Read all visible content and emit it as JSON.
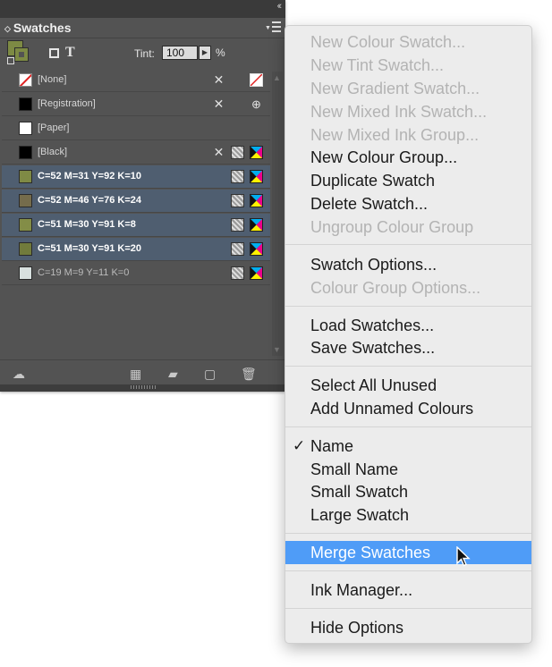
{
  "panel": {
    "tab_title": "Swatches",
    "collapse_glyph": "‹‹",
    "tint_label": "Tint:",
    "tint_value": "100",
    "tint_unit": "%",
    "swatches": [
      {
        "label": "[None]",
        "chip": "#ffffff",
        "kind": "none",
        "selected": false
      },
      {
        "label": "[Registration]",
        "chip": "#000000",
        "kind": "registration",
        "selected": false
      },
      {
        "label": "[Paper]",
        "chip": "#ffffff",
        "kind": "paper",
        "selected": false
      },
      {
        "label": "[Black]",
        "chip": "#000000",
        "kind": "black",
        "selected": false
      },
      {
        "label": "C=52 M=31 Y=92 K=10",
        "chip": "#7f8a45",
        "kind": "process",
        "selected": true
      },
      {
        "label": "C=52 M=46 Y=76 K=24",
        "chip": "#756c4c",
        "kind": "process",
        "selected": true
      },
      {
        "label": "C=51 M=30 Y=91 K=8",
        "chip": "#838d47",
        "kind": "process",
        "selected": true
      },
      {
        "label": "C=51 M=30 Y=91 K=20",
        "chip": "#717b3c",
        "kind": "process",
        "selected": true
      },
      {
        "label": "C=19 M=9 Y=11 K=0",
        "chip": "#d8e0df",
        "kind": "process",
        "selected": false
      }
    ]
  },
  "menu": {
    "items": [
      {
        "label": "New Colour Swatch...",
        "enabled": false
      },
      {
        "label": "New Tint Swatch...",
        "enabled": false
      },
      {
        "label": "New Gradient Swatch...",
        "enabled": false
      },
      {
        "label": "New Mixed Ink Swatch...",
        "enabled": false
      },
      {
        "label": "New Mixed Ink Group...",
        "enabled": false
      },
      {
        "label": "New Colour Group...",
        "enabled": true
      },
      {
        "label": "Duplicate Swatch",
        "enabled": true
      },
      {
        "label": "Delete Swatch...",
        "enabled": true
      },
      {
        "label": "Ungroup Colour Group",
        "enabled": false
      },
      {
        "label": "Swatch Options...",
        "enabled": true
      },
      {
        "label": "Colour Group Options...",
        "enabled": false
      },
      {
        "label": "Load Swatches...",
        "enabled": true
      },
      {
        "label": "Save Swatches...",
        "enabled": true
      },
      {
        "label": "Select All Unused",
        "enabled": true
      },
      {
        "label": "Add Unnamed Colours",
        "enabled": true
      },
      {
        "label": "Name",
        "enabled": true,
        "checked": true
      },
      {
        "label": "Small Name",
        "enabled": true
      },
      {
        "label": "Small Swatch",
        "enabled": true
      },
      {
        "label": "Large Swatch",
        "enabled": true
      },
      {
        "label": "Merge Swatches",
        "enabled": true,
        "highlighted": true
      },
      {
        "label": "Ink Manager...",
        "enabled": true
      },
      {
        "label": "Hide Options",
        "enabled": true
      }
    ],
    "checkmark": "✓"
  },
  "colors": {
    "panel_bg": "#535353",
    "selection_bg": "#4f5e70",
    "menu_bg": "#ececec",
    "menu_highlight": "#4f9cf7",
    "disabled_text": "#b3b3b3"
  }
}
